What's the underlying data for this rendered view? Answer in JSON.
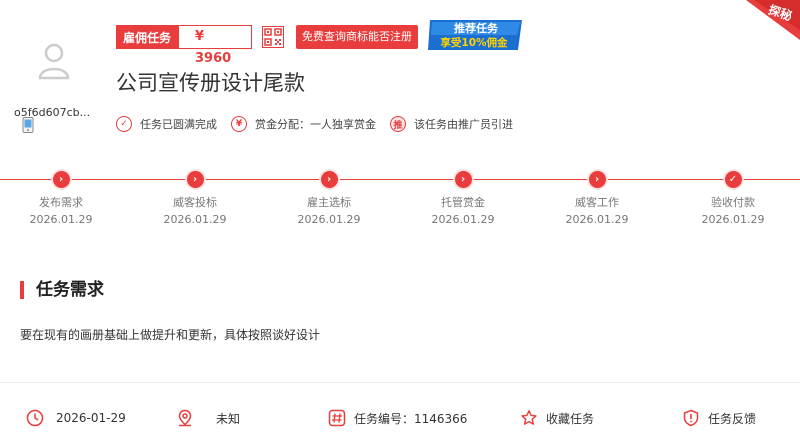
{
  "user": {
    "name": "o5f6d607cb..."
  },
  "header": {
    "type_label": "雇佣任务",
    "price": "¥ 3960",
    "query_button": "免费查询商标能否注册",
    "promo_line1": "推荐任务",
    "promo_line2": "享受10%佣金",
    "corner_label": "探秘"
  },
  "task": {
    "title": "公司宣传册设计尾款"
  },
  "tags": [
    {
      "icon": "check-circle-icon",
      "glyph": "✓",
      "label": "任务已圆满完成"
    },
    {
      "icon": "yen-circle-icon",
      "glyph": "¥",
      "label": "赏金分配：一人独享赏金"
    },
    {
      "icon": "promote-circle-icon",
      "glyph": "推",
      "label": "该任务由推广员引进"
    }
  ],
  "steps": [
    {
      "label": "发布需求",
      "date": "2026.01.29"
    },
    {
      "label": "威客投标",
      "date": "2026.01.29"
    },
    {
      "label": "雇主选标",
      "date": "2026.01.29"
    },
    {
      "label": "托管赏金",
      "date": "2026.01.29"
    },
    {
      "label": "威客工作",
      "date": "2026.01.29"
    },
    {
      "label": "验收付款",
      "date": "2026.01.29"
    }
  ],
  "requirements": {
    "title": "任务需求",
    "text": "要在现有的画册基础上做提升和更新，具体按照谈好设计"
  },
  "footer": {
    "date": "2026-01-29",
    "location": "未知",
    "task_id": "任务编号：1146366",
    "favorite": "收藏任务",
    "feedback": "任务反馈"
  },
  "colors": {
    "accent": "#e93c3c",
    "promo_blue": "#1a6fd1",
    "promo_yellow": "#ffd200"
  }
}
